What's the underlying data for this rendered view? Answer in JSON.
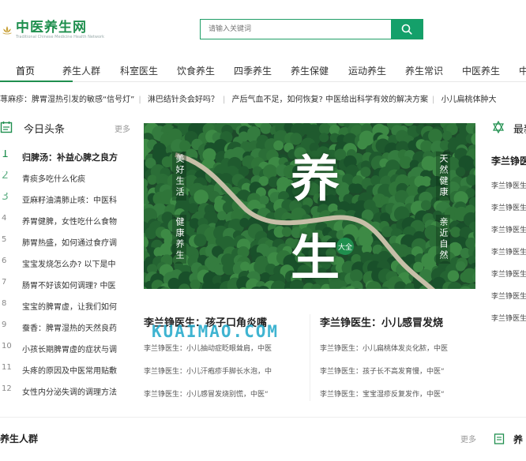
{
  "logo": {
    "title": "中医养生网",
    "subtitle": "Traditional Chinese Medicine Health Network"
  },
  "search": {
    "placeholder": "请输入关键词"
  },
  "nav": [
    "首页",
    "养生人群",
    "科室医生",
    "饮食养生",
    "四季养生",
    "养生保健",
    "运动养生",
    "养生常识",
    "中医养生",
    "中"
  ],
  "ticker": [
    "荨麻疹：脾胃湿热引发的敏感“信号灯”",
    "淋巴结针灸会好吗？",
    "产后气血不足，如何恢复? 中医给出科学有效的解决方案",
    "小儿扁桃体肿大"
  ],
  "headlines": {
    "title": "今日头条",
    "more": "更多",
    "items": [
      {
        "num": "1",
        "text": "归脾汤：补益心脾之良方"
      },
      {
        "num": "2",
        "text": "青痰多吃什么化痰"
      },
      {
        "num": "3",
        "text": "亚麻籽油清肺止咳：中医科"
      },
      {
        "num": "4",
        "text": "养胃健脾，女性吃什么食物"
      },
      {
        "num": "5",
        "text": "肺胃热盛，如何通过食疗调"
      },
      {
        "num": "6",
        "text": "宝宝发烧怎么办? 以下是中"
      },
      {
        "num": "7",
        "text": "肠胃不好该如何调理? 中医"
      },
      {
        "num": "8",
        "text": "宝宝的脾胃虚，让我们如何"
      },
      {
        "num": "9",
        "text": "蚕香：脾胃湿热的天然良药"
      },
      {
        "num": "10",
        "text": "小孩长期脾胃虚的症状与调"
      },
      {
        "num": "11",
        "text": "头疼的原因及中医常用贴敷"
      },
      {
        "num": "12",
        "text": "女性内分泌失调的调理方法"
      }
    ]
  },
  "hero": {
    "big1": "养",
    "big2": "生",
    "badge": "大全",
    "left_col1": "美好生活",
    "left_col2": "健康养生",
    "right_col1": "天然健康",
    "right_col2": "亲近自然"
  },
  "articles_left": {
    "title": "李兰铮医生：孩子口角炎嘴",
    "lines": [
      "李兰铮医生：小儿抽动症眨眼耸肩，中医",
      "李兰铮医生：小儿汗疱疹手脚长水泡，中",
      "李兰铮医生：小儿感冒发烧别慌，中医“"
    ]
  },
  "articles_right": {
    "title": "李兰铮医生：小儿感冒发烧",
    "lines": [
      "李兰铮医生：小儿扁桃体发炎化脓，中医",
      "李兰铮医生：孩子长不高发育慢，中医“",
      "李兰铮医生：宝宝湿疹反复发作，中医“"
    ]
  },
  "watermark": "KUAIMAO.COM",
  "right_panel": {
    "title": "最新",
    "name": "李兰铮医",
    "items": [
      "李兰铮医生",
      "李兰铮医生",
      "李兰铮医生",
      "李兰铮医生",
      "李兰铮医生",
      "李兰铮医生",
      "李兰铮医生",
      "李兰铮医生"
    ]
  },
  "bottom": {
    "title": "养生人群",
    "more": "更多",
    "right_title": "养"
  },
  "colors": {
    "brand": "#1f8f4e",
    "search_button": "#14a06a",
    "watermark": "#1ea7c9"
  }
}
